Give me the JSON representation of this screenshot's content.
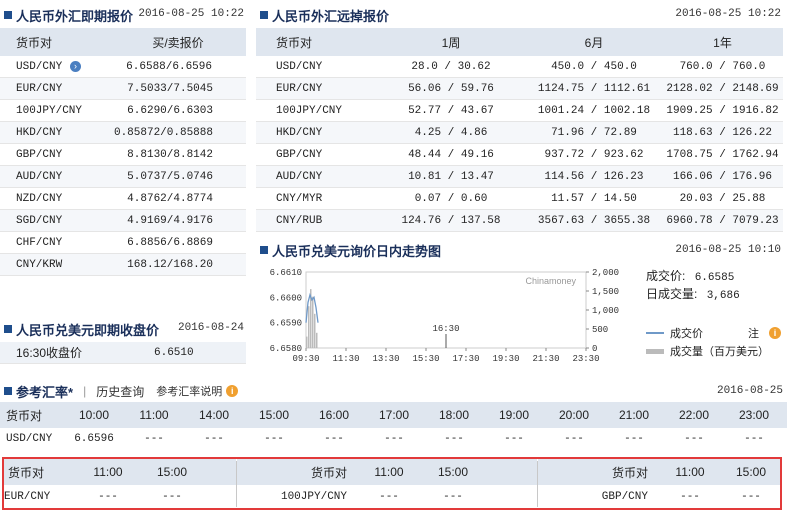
{
  "spot": {
    "title": "人民币外汇即期报价",
    "date": "2016-08-25 10:22",
    "headers": [
      "货币对",
      "买/卖报价"
    ],
    "rows": [
      [
        "USD/CNY",
        "6.6588/6.6596"
      ],
      [
        "EUR/CNY",
        "7.5033/7.5045"
      ],
      [
        "100JPY/CNY",
        "6.6290/6.6303"
      ],
      [
        "HKD/CNY",
        "0.85872/0.85888"
      ],
      [
        "GBP/CNY",
        "8.8130/8.8142"
      ],
      [
        "AUD/CNY",
        "5.0737/5.0746"
      ],
      [
        "NZD/CNY",
        "4.8762/4.8774"
      ],
      [
        "SGD/CNY",
        "4.9169/4.9176"
      ],
      [
        "CHF/CNY",
        "6.8856/6.8869"
      ],
      [
        "CNY/KRW",
        "168.12/168.20"
      ]
    ]
  },
  "forward": {
    "title": "人民币外汇远掉报价",
    "date": "2016-08-25 10:22",
    "headers": [
      "货币对",
      "1周",
      "6月",
      "1年"
    ],
    "rows": [
      [
        "USD/CNY",
        "28.0 / 30.62",
        "450.0 / 450.0",
        "760.0 / 760.0"
      ],
      [
        "EUR/CNY",
        "56.06 / 59.76",
        "1124.75 / 1112.61",
        "2128.02 / 2148.69"
      ],
      [
        "100JPY/CNY",
        "52.77 / 43.67",
        "1001.24 / 1002.18",
        "1909.25 / 1916.82"
      ],
      [
        "HKD/CNY",
        "4.25 / 4.86",
        "71.96 / 72.89",
        "118.63 / 126.22"
      ],
      [
        "GBP/CNY",
        "48.44 / 49.16",
        "937.72 / 923.62",
        "1708.75 / 1762.94"
      ],
      [
        "AUD/CNY",
        "10.81 / 13.47",
        "114.56 / 126.23",
        "166.06 / 176.96"
      ],
      [
        "CNY/MYR",
        "0.07 / 0.60",
        "11.57 / 14.50",
        "20.03 / 25.88"
      ],
      [
        "CNY/RUB",
        "124.76 / 137.58",
        "3567.63 / 3655.38",
        "6960.78 / 7079.23"
      ]
    ]
  },
  "close": {
    "title": "人民币兑美元即期收盘价",
    "date": "2016-08-24",
    "label": "16:30收盘价",
    "value": "6.6510"
  },
  "intraday": {
    "title": "人民币兑美元询价日内走势图",
    "date": "2016-08-25 10:10",
    "trade_price_label": "成交价:",
    "trade_price": "6.6585",
    "volume_label": "日成交量:",
    "volume": "3,686",
    "legend_price": "成交价",
    "legend_volume": "成交量（百万美元）",
    "note_label": "注",
    "watermark": "Chinamoney",
    "annotation": "16:30"
  },
  "chart_data": {
    "type": "line",
    "title": "人民币兑美元询价日内走势图",
    "x_ticks": [
      "09:30",
      "11:30",
      "13:30",
      "15:30",
      "17:30",
      "19:30",
      "21:30",
      "23:30"
    ],
    "y_ticks_left": [
      "6.6610",
      "6.6600",
      "6.6590",
      "6.6580"
    ],
    "y_ticks_right": [
      "2,000",
      "1,500",
      "1,000",
      "500",
      "0"
    ],
    "ylim_left": [
      6.658,
      6.661
    ],
    "ylim_right": [
      0,
      2000
    ],
    "series": [
      {
        "name": "成交价",
        "x": [
          "09:30",
          "09:36",
          "09:42",
          "09:48",
          "09:54",
          "10:00",
          "10:06"
        ],
        "values": [
          6.659,
          6.6598,
          6.6601,
          6.6599,
          6.66,
          6.6596,
          6.659
        ]
      },
      {
        "name": "成交量（百万美元）",
        "x": [
          "09:30",
          "09:36",
          "09:42",
          "09:48",
          "09:54",
          "10:00"
        ],
        "values": [
          300,
          1100,
          1550,
          1350,
          900,
          400
        ]
      }
    ],
    "annotation_x": "16:30"
  },
  "reference": {
    "title": "参考汇率*",
    "history_link": "历史查询",
    "note_link": "参考汇率说明",
    "date": "2016-08-25",
    "headers": [
      "货币对",
      "10:00",
      "11:00",
      "14:00",
      "15:00",
      "16:00",
      "17:00",
      "18:00",
      "19:00",
      "20:00",
      "21:00",
      "22:00",
      "23:00"
    ],
    "row": [
      "USD/CNY",
      "6.6596",
      "---",
      "---",
      "---",
      "---",
      "---",
      "---",
      "---",
      "---",
      "---",
      "---",
      "---"
    ],
    "sub_tables": [
      {
        "headers": [
          "货币对",
          "11:00",
          "15:00"
        ],
        "row": [
          "EUR/CNY",
          "---",
          "---"
        ]
      },
      {
        "headers": [
          "货币对",
          "11:00",
          "15:00"
        ],
        "row": [
          "100JPY/CNY",
          "---",
          "---"
        ]
      },
      {
        "headers": [
          "货币对",
          "11:00",
          "15:00"
        ],
        "row": [
          "GBP/CNY",
          "---",
          "---"
        ]
      }
    ]
  }
}
